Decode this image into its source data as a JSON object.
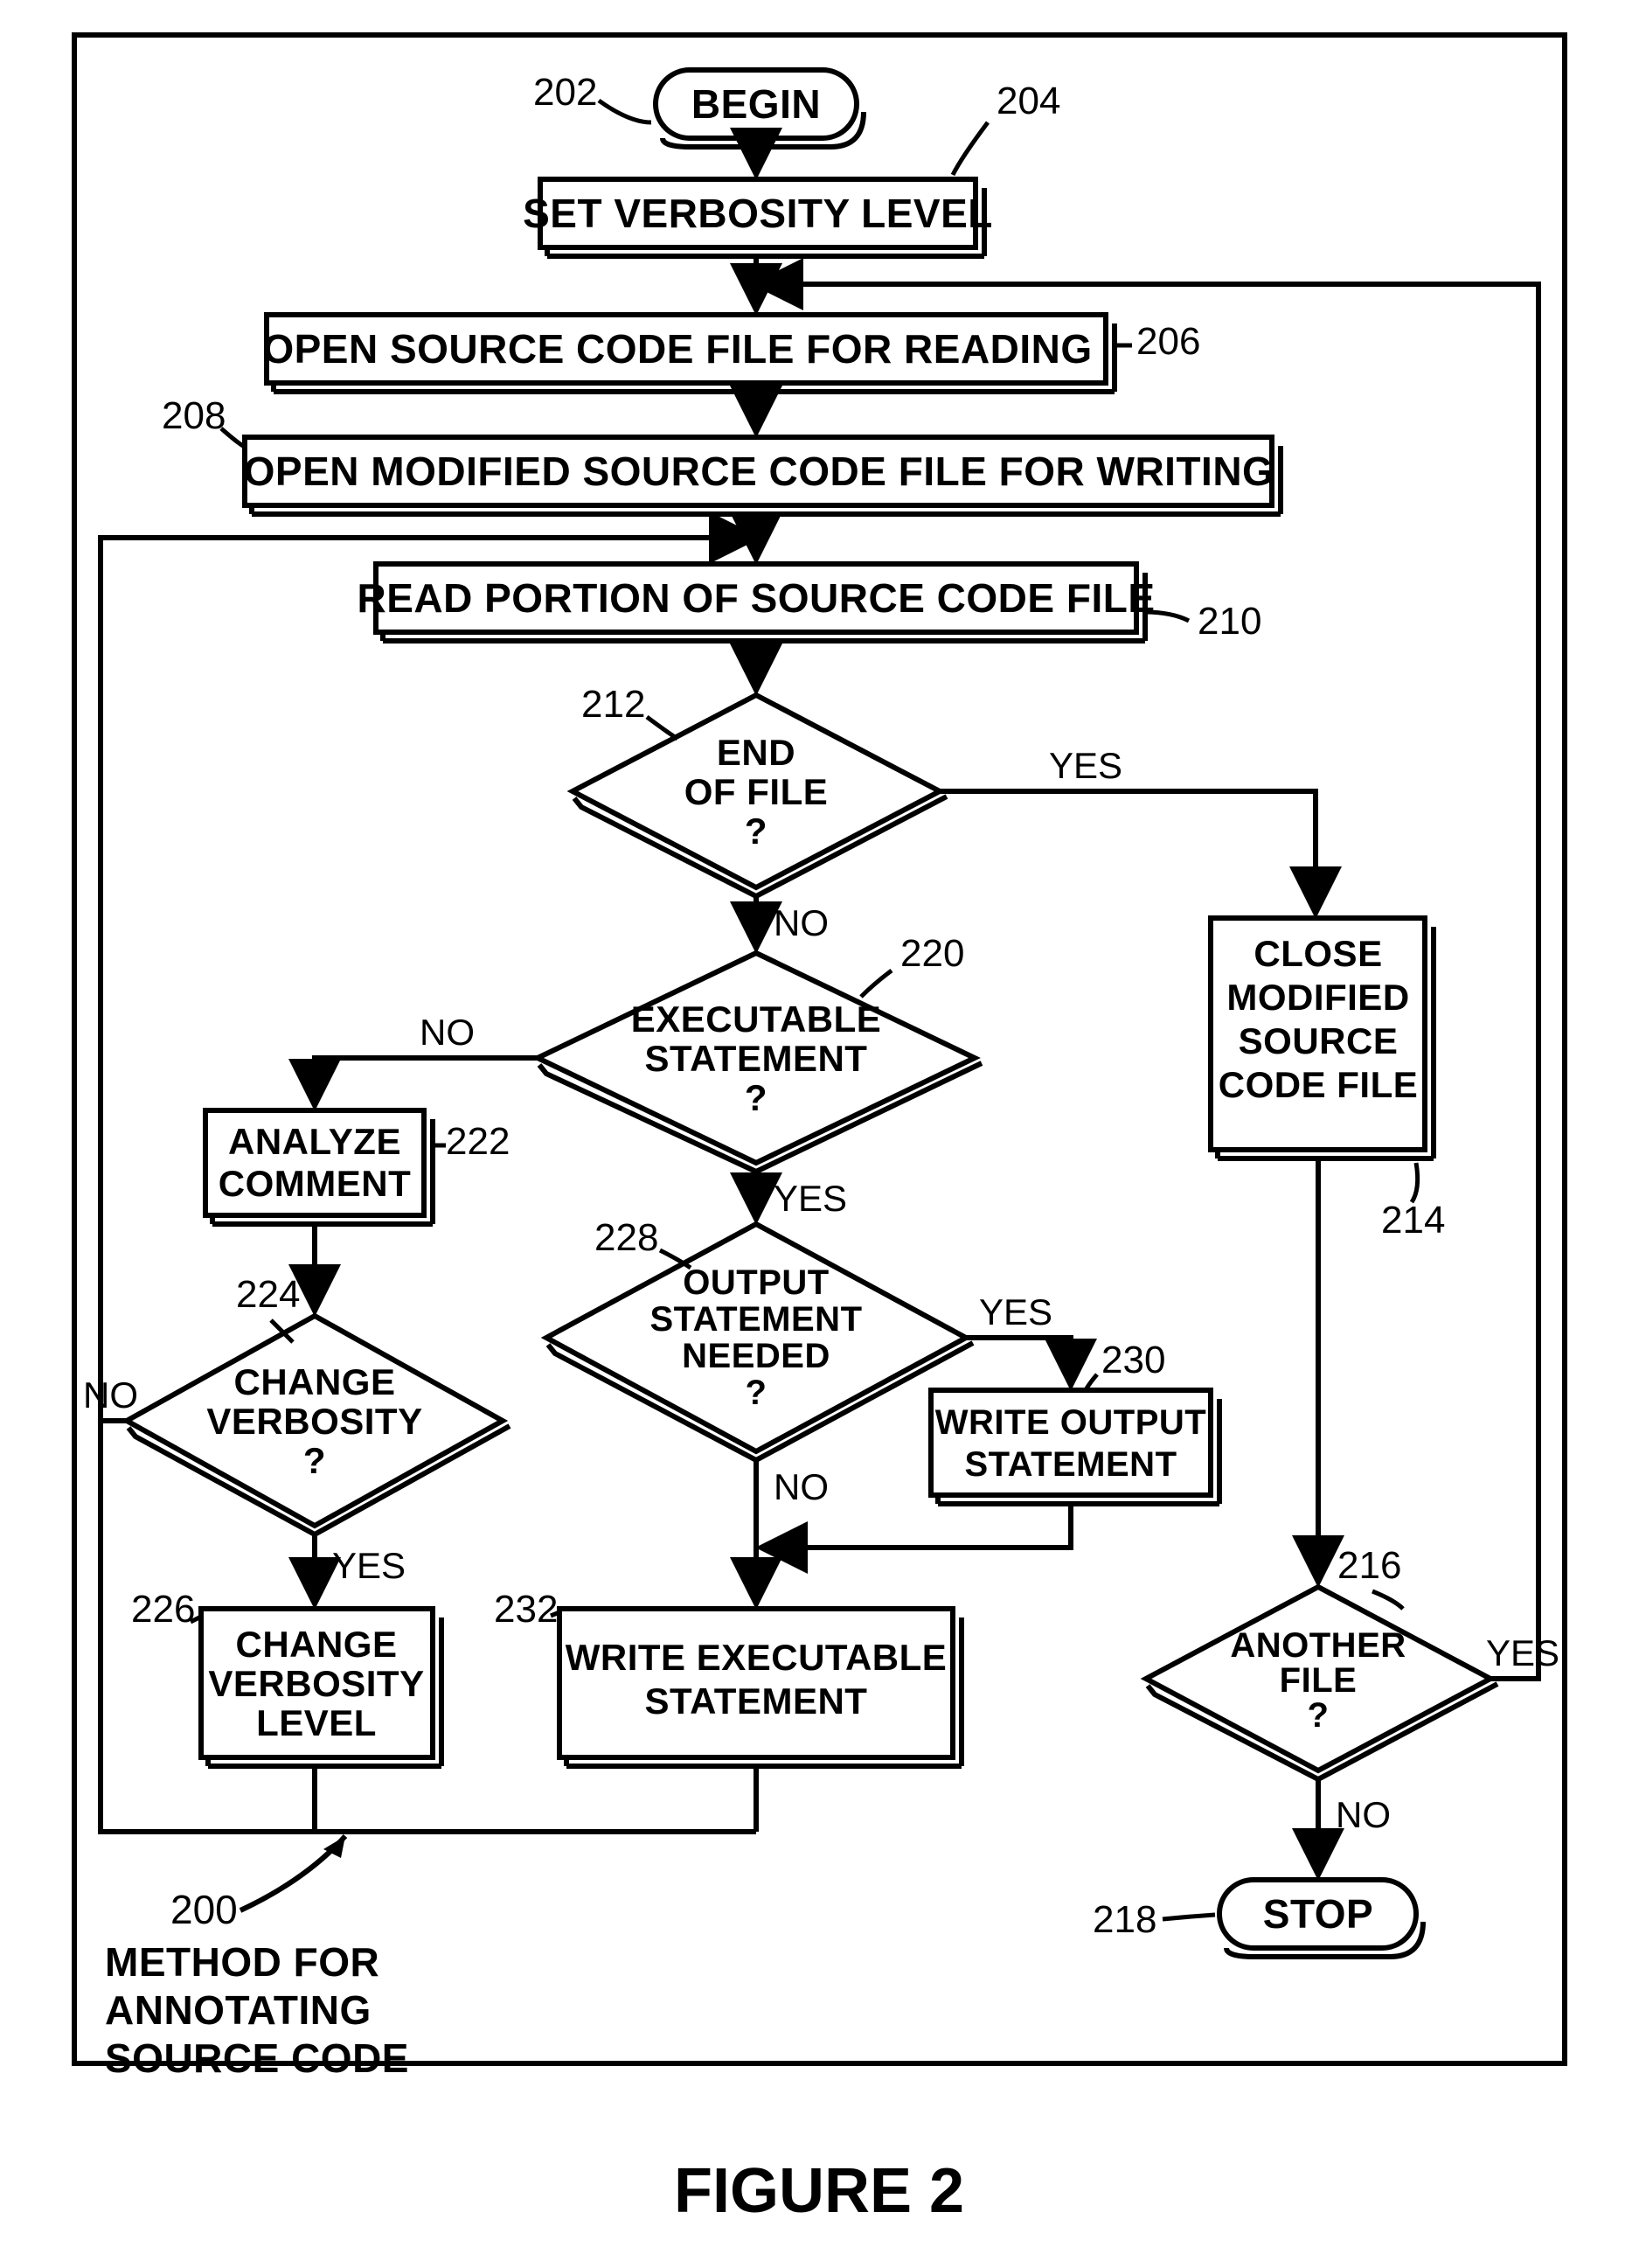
{
  "figure_title": "FIGURE 2",
  "caption": {
    "ref": "200",
    "line1": "METHOD FOR",
    "line2": "ANNOTATING",
    "line3": "SOURCE CODE"
  },
  "nodes": {
    "begin": "BEGIN",
    "stop": "STOP",
    "set_verbosity": "SET VERBOSITY LEVEL",
    "open_read": "OPEN SOURCE CODE FILE FOR READING",
    "open_write": "OPEN MODIFIED SOURCE CODE FILE FOR WRITING",
    "read_portion": "READ PORTION OF SOURCE CODE FILE",
    "eof_l1": "END",
    "eof_l2": "OF FILE",
    "eof_l3": "?",
    "exec_l1": "EXECUTABLE",
    "exec_l2": "STATEMENT",
    "exec_l3": "?",
    "analyze_l1": "ANALYZE",
    "analyze_l2": "COMMENT",
    "chgv_l1": "CHANGE",
    "chgv_l2": "VERBOSITY",
    "chgv_l3": "?",
    "chgvlvl_l1": "CHANGE",
    "chgvlvl_l2": "VERBOSITY",
    "chgvlvl_l3": "LEVEL",
    "out_l1": "OUTPUT",
    "out_l2": "STATEMENT",
    "out_l3": "NEEDED",
    "out_l4": "?",
    "wout_l1": "WRITE OUTPUT",
    "wout_l2": "STATEMENT",
    "wexec_l1": "WRITE EXECUTABLE",
    "wexec_l2": "STATEMENT",
    "close_l1": "CLOSE",
    "close_l2": "MODIFIED",
    "close_l3": "SOURCE",
    "close_l4": "CODE FILE",
    "another_l1": "ANOTHER",
    "another_l2": "FILE",
    "another_l3": "?"
  },
  "refs": {
    "r202": "202",
    "r204": "204",
    "r206": "206",
    "r208": "208",
    "r210": "210",
    "r212": "212",
    "r214": "214",
    "r216": "216",
    "r218": "218",
    "r220": "220",
    "r222": "222",
    "r224": "224",
    "r226": "226",
    "r228": "228",
    "r230": "230",
    "r232": "232"
  },
  "edges": {
    "yes": "YES",
    "no": "NO"
  },
  "chart_data": {
    "type": "flowchart",
    "title": "Method for Annotating Source Code",
    "nodes": [
      {
        "id": "begin",
        "ref": null,
        "shape": "terminator",
        "label": "BEGIN"
      },
      {
        "id": "set_verbosity",
        "ref": "204",
        "shape": "process",
        "label": "SET VERBOSITY LEVEL"
      },
      {
        "id": "open_read",
        "ref": "206",
        "shape": "process",
        "label": "OPEN SOURCE CODE FILE FOR READING"
      },
      {
        "id": "open_write",
        "ref": "208",
        "shape": "process",
        "label": "OPEN MODIFIED SOURCE CODE FILE FOR WRITING"
      },
      {
        "id": "read_portion",
        "ref": "210",
        "shape": "process",
        "label": "READ PORTION OF SOURCE CODE FILE"
      },
      {
        "id": "eof",
        "ref": "212",
        "shape": "decision",
        "label": "END OF FILE ?"
      },
      {
        "id": "close_file",
        "ref": "214",
        "shape": "process",
        "label": "CLOSE MODIFIED SOURCE CODE FILE"
      },
      {
        "id": "another_file",
        "ref": "216",
        "shape": "decision",
        "label": "ANOTHER FILE ?"
      },
      {
        "id": "stop",
        "ref": "218",
        "shape": "terminator",
        "label": "STOP"
      },
      {
        "id": "exec_stmt",
        "ref": "220",
        "shape": "decision",
        "label": "EXECUTABLE STATEMENT ?"
      },
      {
        "id": "analyze_comment",
        "ref": "222",
        "shape": "process",
        "label": "ANALYZE COMMENT"
      },
      {
        "id": "change_verbosity",
        "ref": "224",
        "shape": "decision",
        "label": "CHANGE VERBOSITY ?"
      },
      {
        "id": "change_verbosity_level",
        "ref": "226",
        "shape": "process",
        "label": "CHANGE VERBOSITY LEVEL"
      },
      {
        "id": "output_needed",
        "ref": "228",
        "shape": "decision",
        "label": "OUTPUT STATEMENT NEEDED ?"
      },
      {
        "id": "write_output",
        "ref": "230",
        "shape": "process",
        "label": "WRITE OUTPUT STATEMENT"
      },
      {
        "id": "write_exec",
        "ref": "232",
        "shape": "process",
        "label": "WRITE EXECUTABLE STATEMENT"
      }
    ],
    "edges": [
      {
        "from": "begin",
        "to": "set_verbosity",
        "label": null
      },
      {
        "from": "set_verbosity",
        "to": "open_read",
        "label": null
      },
      {
        "from": "open_read",
        "to": "open_write",
        "label": null
      },
      {
        "from": "open_write",
        "to": "read_portion",
        "label": null
      },
      {
        "from": "read_portion",
        "to": "eof",
        "label": null
      },
      {
        "from": "eof",
        "to": "close_file",
        "label": "YES"
      },
      {
        "from": "eof",
        "to": "exec_stmt",
        "label": "NO"
      },
      {
        "from": "exec_stmt",
        "to": "analyze_comment",
        "label": "NO"
      },
      {
        "from": "exec_stmt",
        "to": "output_needed",
        "label": "YES"
      },
      {
        "from": "analyze_comment",
        "to": "change_verbosity",
        "label": null
      },
      {
        "from": "change_verbosity",
        "to": "read_portion",
        "label": "NO"
      },
      {
        "from": "change_verbosity",
        "to": "change_verbosity_level",
        "label": "YES"
      },
      {
        "from": "change_verbosity_level",
        "to": "read_portion",
        "label": null
      },
      {
        "from": "output_needed",
        "to": "write_exec",
        "label": "NO"
      },
      {
        "from": "output_needed",
        "to": "write_output",
        "label": "YES"
      },
      {
        "from": "write_output",
        "to": "write_exec",
        "label": null
      },
      {
        "from": "write_exec",
        "to": "read_portion",
        "label": null
      },
      {
        "from": "close_file",
        "to": "another_file",
        "label": null
      },
      {
        "from": "another_file",
        "to": "open_read",
        "label": "YES"
      },
      {
        "from": "another_file",
        "to": "stop",
        "label": "NO"
      }
    ],
    "overall_ref": "200",
    "begin_leader_ref": "202"
  }
}
